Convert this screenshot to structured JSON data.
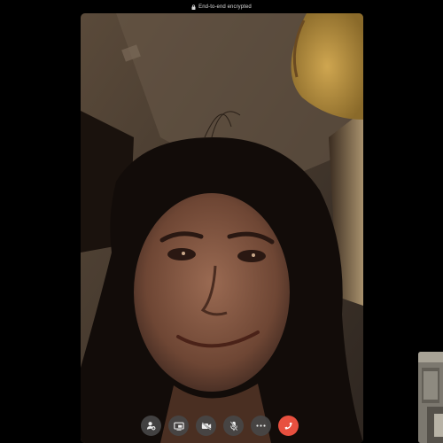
{
  "banner": {
    "text": "End-to-end encrypted",
    "icon": "lock-icon"
  },
  "remote_video": {
    "description_icon": "video-feed"
  },
  "self_preview": {
    "icon": "self-view"
  },
  "controls": [
    {
      "name": "add-person-button",
      "icon": "add-person-icon"
    },
    {
      "name": "share-screen-button",
      "icon": "screen-share-icon"
    },
    {
      "name": "camera-off-button",
      "icon": "video-off-icon"
    },
    {
      "name": "mute-button",
      "icon": "mic-off-icon"
    },
    {
      "name": "more-options-button",
      "icon": "more-icon"
    },
    {
      "name": "end-call-button",
      "icon": "hang-up-icon"
    }
  ],
  "colors": {
    "end_call": "#e8503f",
    "control_bg": "#464646",
    "background": "#000000"
  }
}
